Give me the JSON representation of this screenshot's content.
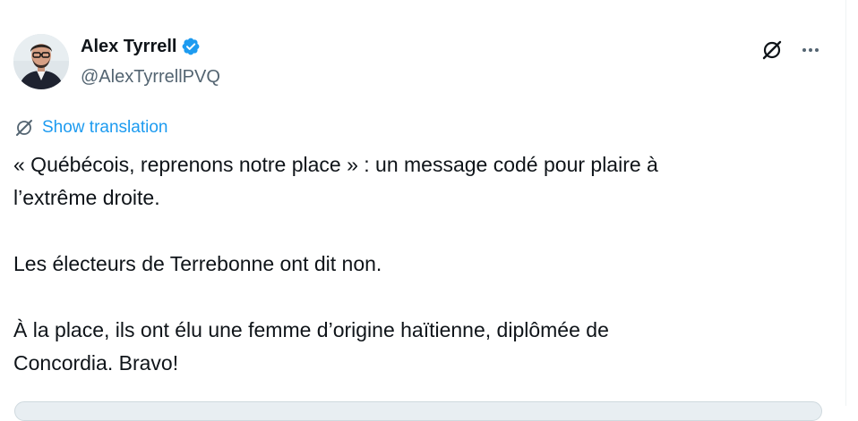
{
  "tweet": {
    "author": {
      "display_name": "Alex Tyrrell",
      "handle": "@AlexTyrrellPVQ",
      "verified": true
    },
    "translation_label": "Show translation",
    "lines": [
      "« Québécois, reprenons notre place » : un message codé pour plaire à",
      "l’extrême droite.",
      "Les électeurs de Terrebonne ont dit non.",
      "À la place, ils ont élu une femme d’origine haïtienne, diplômée de",
      "Concordia. Bravo!"
    ]
  },
  "icons": {
    "verified": "verified-badge-icon",
    "grok": "grok-icon",
    "more": "more-options-icon",
    "translate": "translate-icon"
  },
  "colors": {
    "accent": "#1d9bf0",
    "text": "#0f1419",
    "secondary": "#536471"
  }
}
